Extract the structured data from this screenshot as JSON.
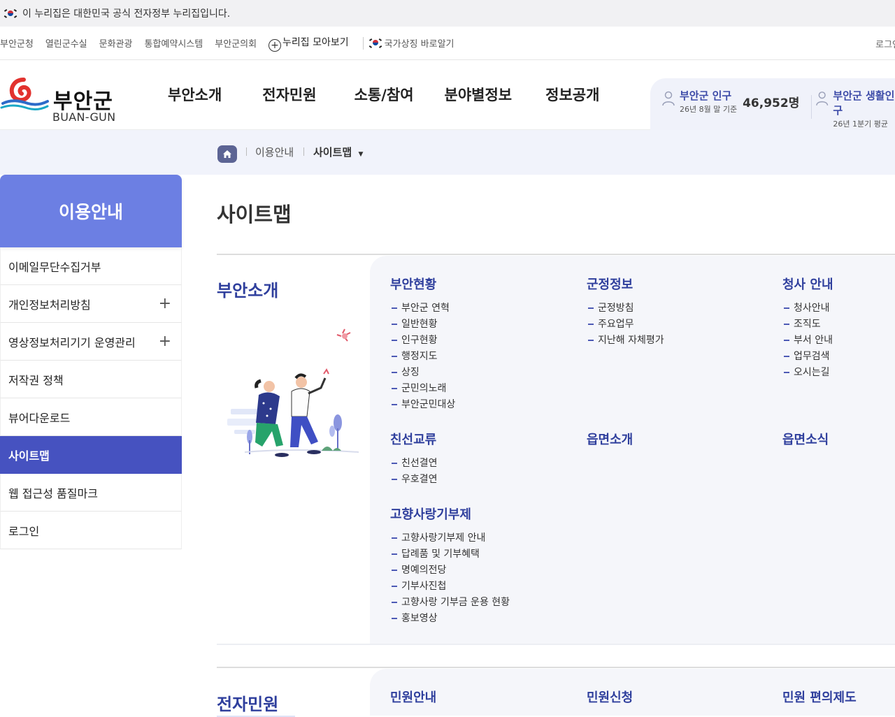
{
  "gov_banner": {
    "text": "이 누리집은 대한민국 공식 전자정부 누리집입니다."
  },
  "util": {
    "links": [
      "부안군청",
      "열린군수실",
      "문화관광",
      "통합예약시스템",
      "부안군의회"
    ],
    "nuri": "누리집 모아보기",
    "symbol": "국가상징 바로알기",
    "login": "로그인"
  },
  "logo": {
    "kr": "부안군",
    "en": "BUAN-GUN"
  },
  "gnb": [
    "부안소개",
    "전자민원",
    "소통/참여",
    "분야별정보",
    "정보공개"
  ],
  "stats": {
    "population": {
      "label": "부안군 인구",
      "sub": "26년 8월 말 기준",
      "value": "46,952명"
    },
    "living": {
      "label": "부안군 생활인구",
      "sub": "26년 1분기 평균"
    }
  },
  "breadcrumb": {
    "first": "이용안내",
    "current": "사이트맵"
  },
  "sidebar": {
    "title": "이용안내",
    "items": [
      {
        "label": "이메일무단수집거부"
      },
      {
        "label": "개인정보처리방침"
      },
      {
        "label": "영상정보처리기기 운영관리"
      },
      {
        "label": "저작권 정책"
      },
      {
        "label": "뷰어다운로드"
      },
      {
        "label": "사이트맵"
      },
      {
        "label": "웹 접근성 품질마크"
      },
      {
        "label": "로그인"
      }
    ]
  },
  "main": {
    "title": "사이트맵",
    "section1": {
      "label": "부안소개",
      "groups": [
        {
          "title": "부안현황",
          "items": [
            "부안군 연혁",
            "일반현황",
            "인구현황",
            "행정지도",
            "상징",
            "군민의노래",
            "부안군민대상"
          ]
        },
        {
          "title": "군정정보",
          "items": [
            "군정방침",
            "주요업무",
            "지난해 자체평가"
          ]
        },
        {
          "title": "청사 안내",
          "items": [
            "청사안내",
            "조직도",
            "부서 안내",
            "업무검색",
            "오시는길"
          ]
        },
        {
          "title": "친선교류",
          "items": [
            "친선결연",
            "우호결연"
          ]
        },
        {
          "title": "읍면소개",
          "items": []
        },
        {
          "title": "읍면소식",
          "items": []
        },
        {
          "title": "고향사랑기부제",
          "items": [
            "고향사랑기부제 안내",
            "답례품 및 기부혜택",
            "명예의전당",
            "기부사진첩",
            "고향사랑 기부금 운용 현황",
            "홍보영상"
          ]
        }
      ]
    },
    "section2": {
      "label": "전자민원",
      "groups": [
        {
          "title": "민원안내"
        },
        {
          "title": "민원신청"
        },
        {
          "title": "민원 편의제도"
        }
      ]
    }
  }
}
